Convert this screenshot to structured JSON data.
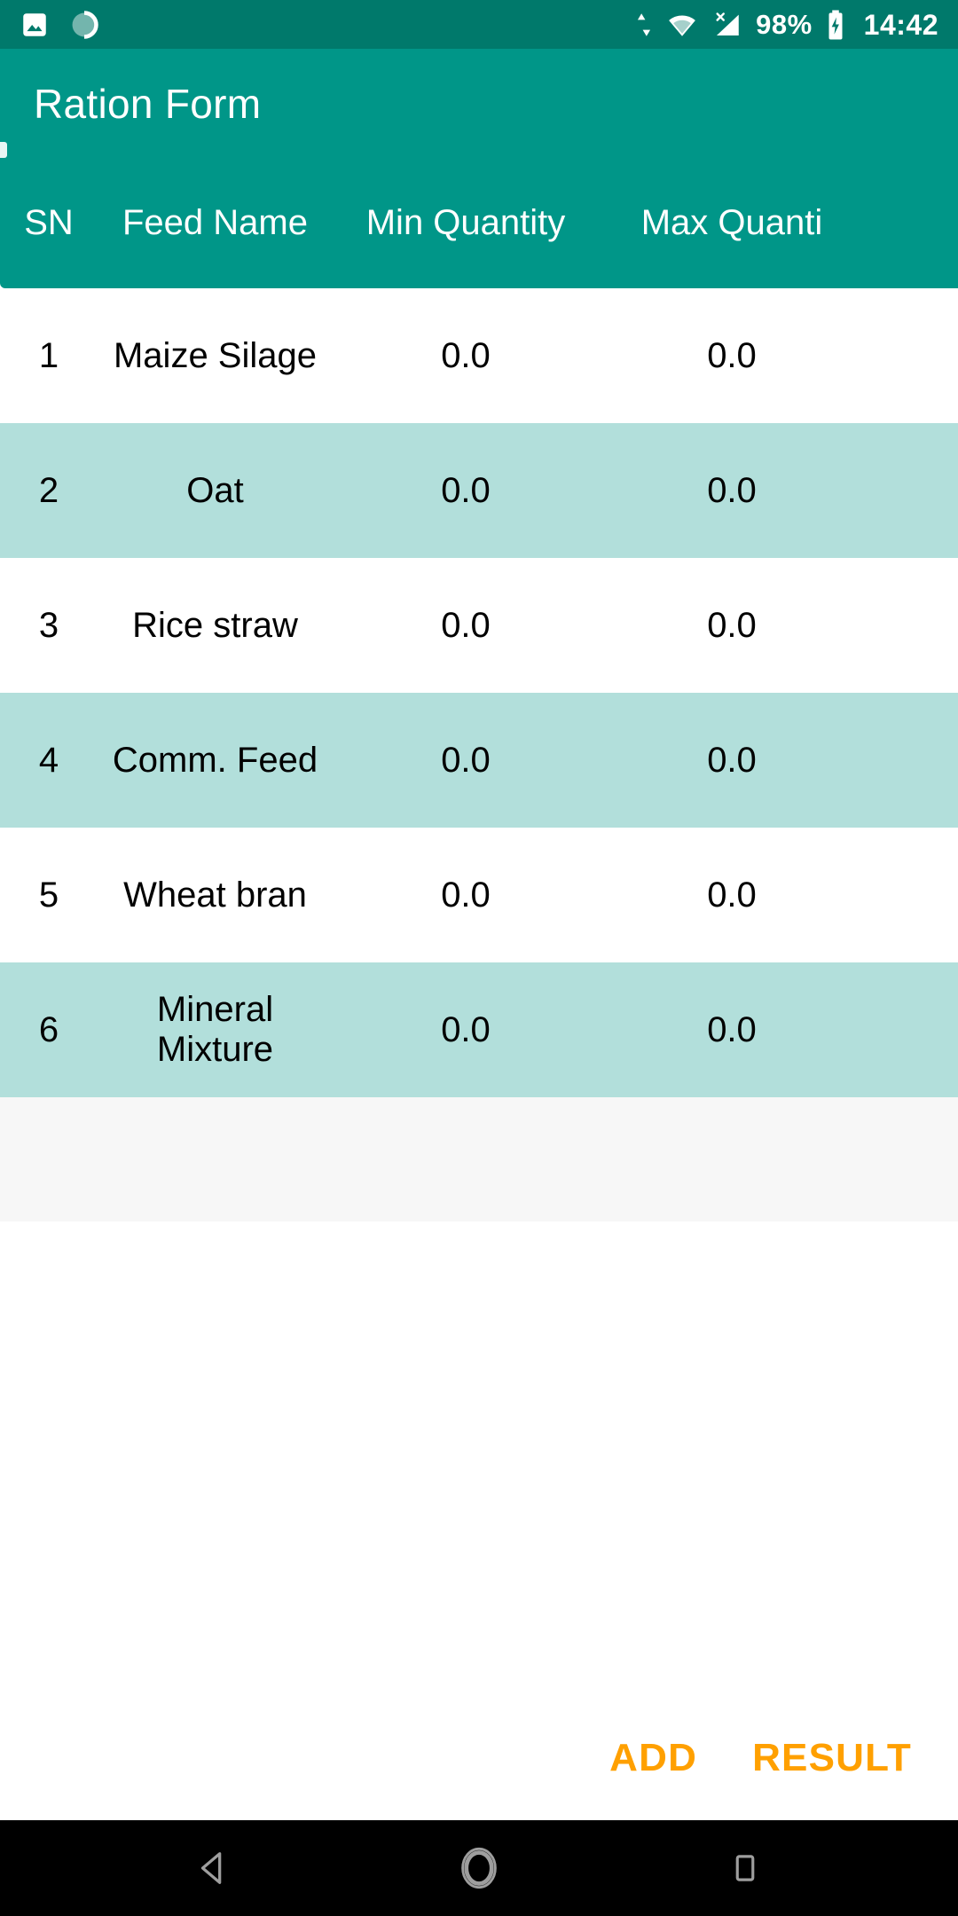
{
  "status_bar": {
    "background": "#00796b",
    "left_icons": [
      {
        "name": "image-icon",
        "label": "Image"
      },
      {
        "name": "sync-spinner-icon",
        "label": "Sync"
      }
    ],
    "right_icons": [
      {
        "name": "data-transfer-icon",
        "label": "Data transfer"
      },
      {
        "name": "wifi-icon",
        "label": "Wi-Fi"
      },
      {
        "name": "no-sim-signal-icon",
        "label": "No SIM"
      }
    ],
    "battery_percent": "98%",
    "battery_state": "charging",
    "clock": "14:42"
  },
  "app_bar": {
    "title": "Ration Form",
    "background": "#009688",
    "title_color": "#ffffff"
  },
  "table": {
    "header_background": "#009688",
    "row_odd_background": "#ffffff",
    "row_even_background": "#b2dfdb",
    "columns": [
      "SN",
      "Feed Name",
      "Min Quantity",
      "Max Quantity"
    ],
    "columns_visible": [
      "SN",
      "Feed Name",
      "Min Quantity",
      "Max Quanti"
    ],
    "rows": [
      {
        "sn": "1",
        "feed_name": "Maize Silage",
        "min_quantity": "0.0",
        "max_quantity": "0.0"
      },
      {
        "sn": "2",
        "feed_name": "Oat",
        "min_quantity": "0.0",
        "max_quantity": "0.0"
      },
      {
        "sn": "3",
        "feed_name": "Rice straw",
        "min_quantity": "0.0",
        "max_quantity": "0.0"
      },
      {
        "sn": "4",
        "feed_name": "Comm. Feed",
        "min_quantity": "0.0",
        "max_quantity": "0.0"
      },
      {
        "sn": "5",
        "feed_name": "Wheat bran",
        "min_quantity": "0.0",
        "max_quantity": "0.0"
      },
      {
        "sn": "6",
        "feed_name": "Mineral Mixture",
        "min_quantity": "0.0",
        "max_quantity": "0.0"
      }
    ]
  },
  "actions": {
    "add_label": "ADD",
    "result_label": "RESULT",
    "accent_color": "#ffa000"
  },
  "nav_bar": {
    "background": "#000000",
    "buttons": [
      {
        "name": "nav-back-button",
        "label": "Back"
      },
      {
        "name": "nav-home-button",
        "label": "Home"
      },
      {
        "name": "nav-recents-button",
        "label": "Recents"
      }
    ]
  }
}
